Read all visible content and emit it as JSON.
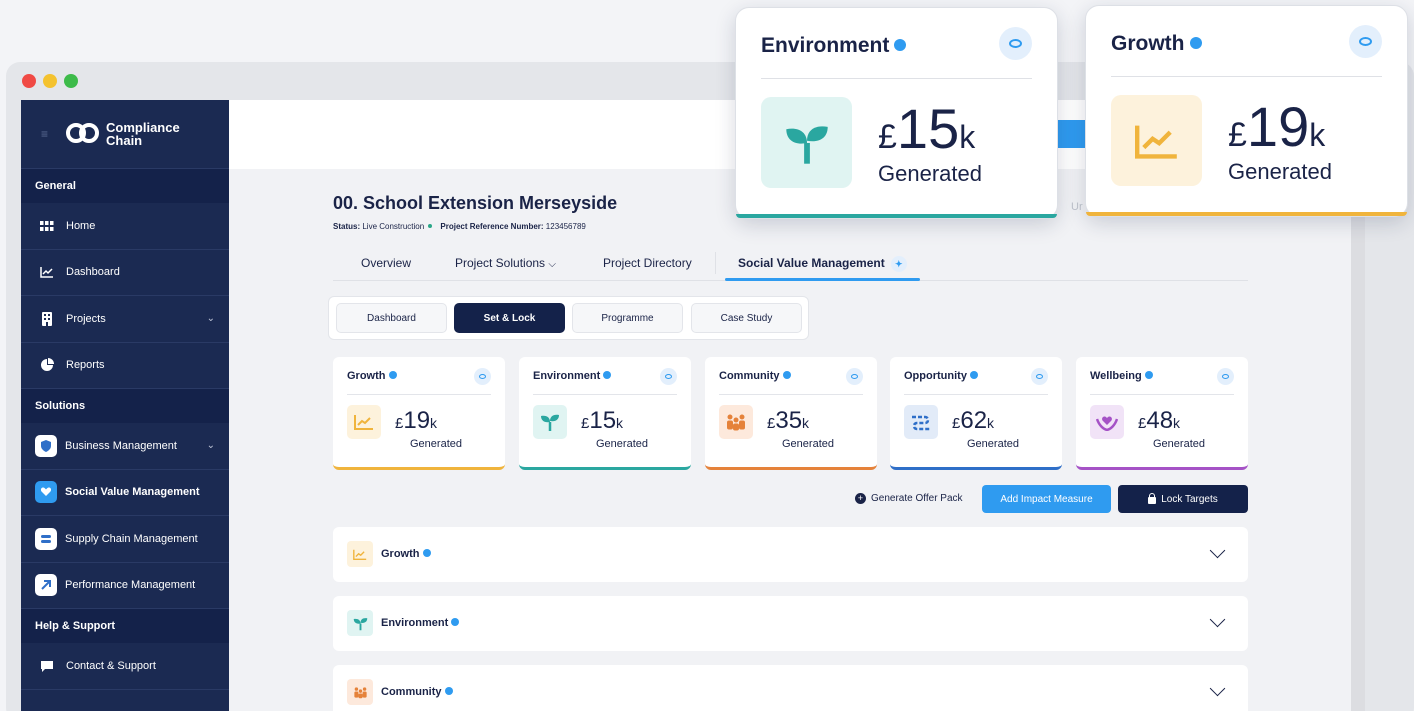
{
  "colors": {
    "growth": "#f0b43c",
    "environment": "#2aa7a0",
    "community": "#e5823a",
    "opportunity": "#2f6fc8",
    "wellbeing": "#a552c6",
    "primary": "#2f9bf0",
    "navy": "#14224a"
  },
  "sidebar": {
    "logo": "Compliance Chain",
    "sections": [
      {
        "heading": "General",
        "items": [
          {
            "label": "Home",
            "icon": "grid-icon"
          },
          {
            "label": "Dashboard",
            "icon": "chart-icon"
          },
          {
            "label": "Projects",
            "icon": "building-icon",
            "expand": true
          },
          {
            "label": "Reports",
            "icon": "pie-icon"
          }
        ]
      },
      {
        "heading": "Solutions",
        "items": [
          {
            "label": "Business Management",
            "icon": "shield-icon",
            "expand": true
          },
          {
            "label": "Social Value Management",
            "icon": "heart-hand-icon"
          },
          {
            "label": "Supply Chain Management",
            "icon": "chain-icon"
          },
          {
            "label": "Performance Management",
            "icon": "arrow-up-icon"
          }
        ]
      },
      {
        "heading": "Help & Support",
        "items": [
          {
            "label": "Contact & Support",
            "icon": "chat-icon"
          }
        ]
      }
    ]
  },
  "project": {
    "title": "00. School Extension Merseyside",
    "status_label": "Status:",
    "status_value": "Live Construction",
    "ref_label": "Project Reference Number:",
    "ref_value": "123456789"
  },
  "tabs": [
    "Overview",
    "Project Solutions",
    "Project Directory",
    "Social Value Management"
  ],
  "subtabs": [
    "Dashboard",
    "Set & Lock",
    "Programme",
    "Case Study"
  ],
  "cards": [
    {
      "title": "Growth",
      "amount": "19",
      "unit": "k",
      "currency": "£",
      "label": "Generated"
    },
    {
      "title": "Environment",
      "amount": "15",
      "unit": "k",
      "currency": "£",
      "label": "Generated"
    },
    {
      "title": "Community",
      "amount": "35",
      "unit": "k",
      "currency": "£",
      "label": "Generated"
    },
    {
      "title": "Opportunity",
      "amount": "62",
      "unit": "k",
      "currency": "£",
      "label": "Generated"
    },
    {
      "title": "Wellbeing",
      "amount": "48",
      "unit": "k",
      "currency": "£",
      "label": "Generated"
    }
  ],
  "actions": {
    "generate": "Generate Offer Pack",
    "add": "Add Impact Measure",
    "lock": "Lock Targets"
  },
  "accordion": [
    "Growth",
    "Environment",
    "Community"
  ],
  "popups": [
    {
      "title": "Environment",
      "amount": "15",
      "unit": "k",
      "currency": "£",
      "label": "Generated"
    },
    {
      "title": "Growth",
      "amount": "19",
      "unit": "k",
      "currency": "£",
      "label": "Generated"
    }
  ],
  "faded_text": "Ur"
}
